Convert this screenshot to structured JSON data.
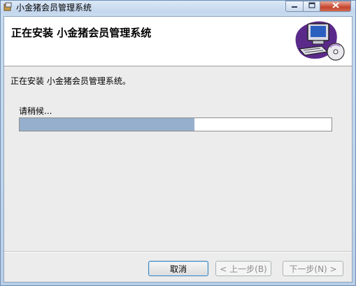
{
  "window": {
    "title": "小金猪会员管理系统"
  },
  "banner": {
    "title": "正在安装 小金猪会员管理系统"
  },
  "main": {
    "status_text": "正在安装 小金猪会员管理系统。",
    "wait_label": "请稍候...",
    "progress_fraction": 0.56
  },
  "buttons": {
    "cancel": "取消",
    "back": "< 上一步(B)",
    "next": "下一步(N) >"
  },
  "colors": {
    "progress_fill": "#96afcc",
    "banner_bg": "#ffffff",
    "client_bg": "#ececec"
  },
  "icons": {
    "app": "installer-app-icon",
    "banner_art": "computer-with-disc-icon",
    "minimize": "minimize-icon",
    "maximize": "maximize-icon",
    "close": "close-icon"
  }
}
